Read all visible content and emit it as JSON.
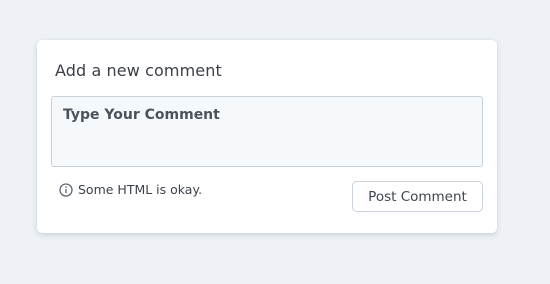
{
  "comment_form": {
    "title": "Add a new comment",
    "textarea": {
      "placeholder": "Type Your Comment",
      "value": ""
    },
    "hint": {
      "icon": "info-icon",
      "text": "Some HTML is okay."
    },
    "submit_label": "Post Comment"
  },
  "colors": {
    "page_background": "#eef2f6",
    "card_background": "#ffffff",
    "textarea_background": "#f6f9fc",
    "border": "#c9d1da",
    "text": "#3a3f47"
  }
}
